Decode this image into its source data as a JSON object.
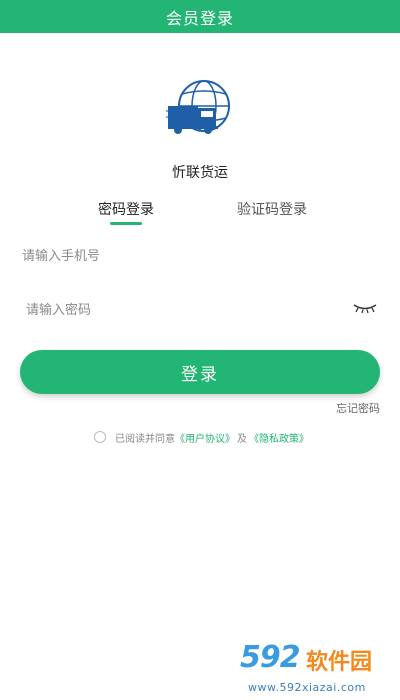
{
  "header": {
    "title": "会员登录"
  },
  "app": {
    "name": "忻联货运",
    "logo": "truck-globe-logo"
  },
  "tabs": [
    {
      "label": "密码登录",
      "active": true
    },
    {
      "label": "验证码登录",
      "active": false
    }
  ],
  "form": {
    "phone_placeholder": "请输入手机号",
    "phone_value": "",
    "password_placeholder": "请输入密码",
    "password_value": "",
    "password_visibility_icon": "eye-closed-icon"
  },
  "actions": {
    "login_label": "登录",
    "forgot_label": "忘记密码"
  },
  "agreement": {
    "prefix": "已阅读并同意",
    "user_agreement": "《用户协议》",
    "joiner": "及",
    "privacy_policy": "《隐私政策》",
    "checked": false
  },
  "watermark": {
    "number": "592",
    "site_name": "软件园",
    "url": "www.592xiazai.com"
  },
  "colors": {
    "primary": "#23b573",
    "background": "#ffffff"
  }
}
